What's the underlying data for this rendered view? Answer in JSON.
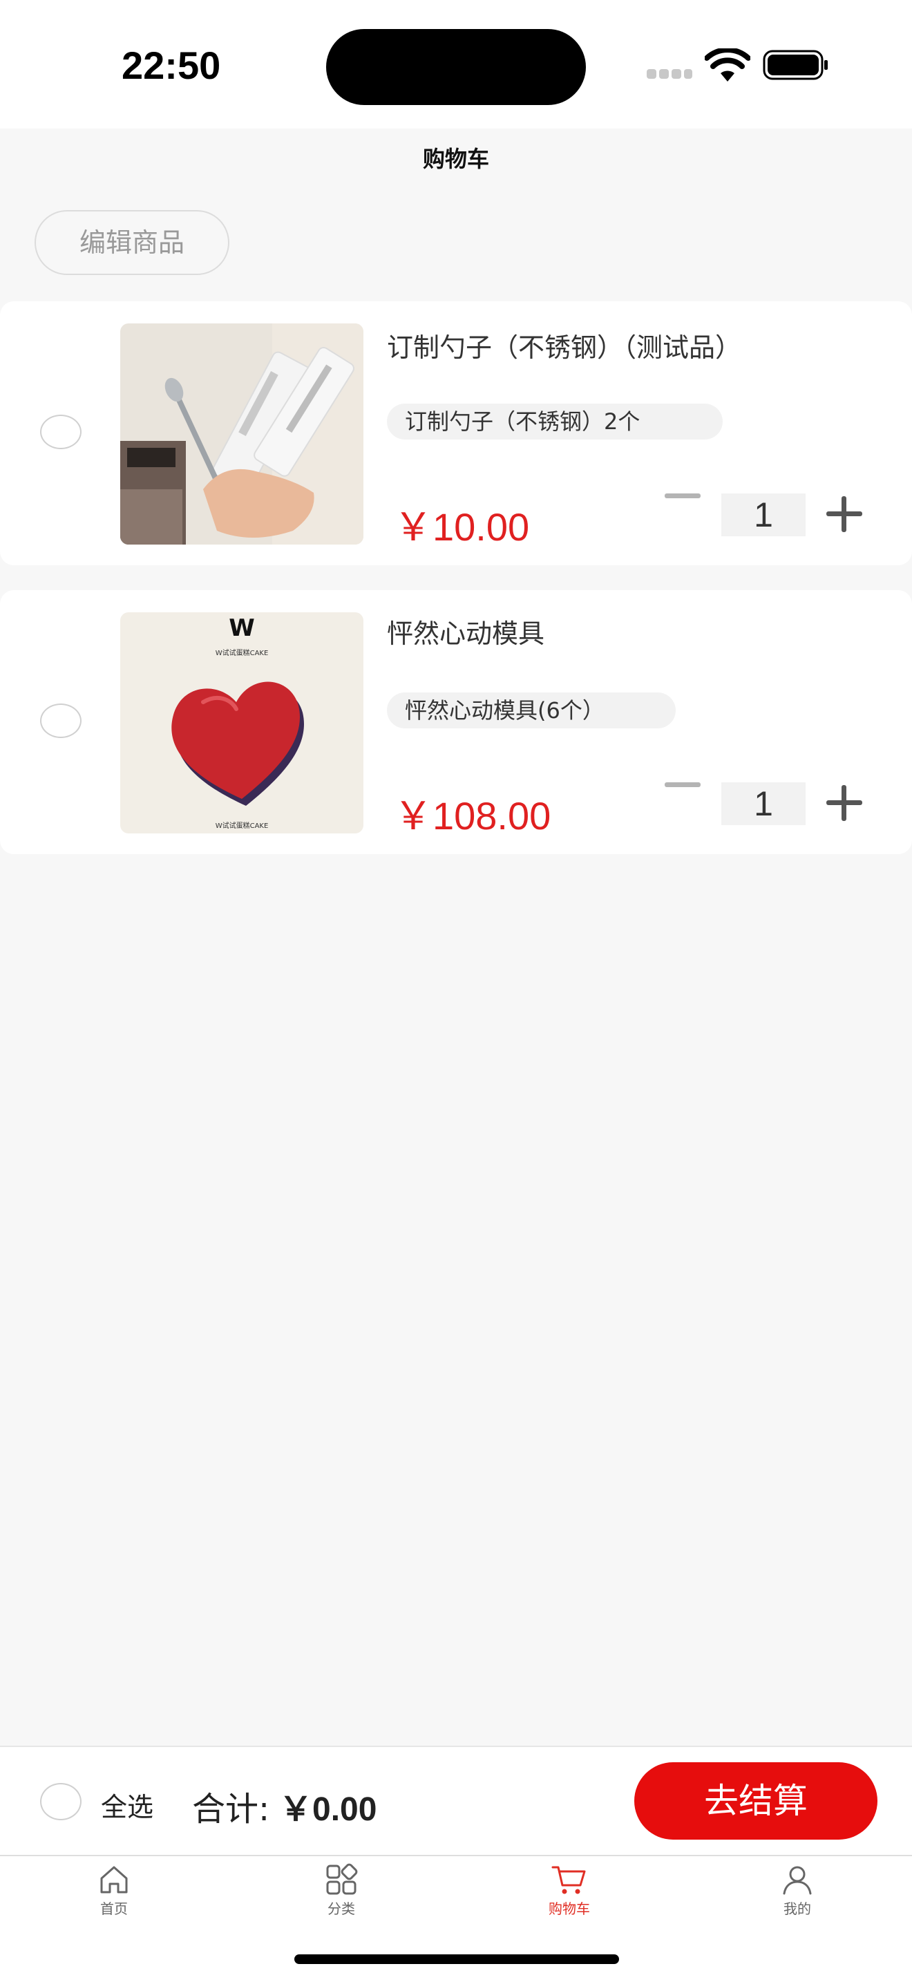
{
  "status_bar": {
    "time": "22:50"
  },
  "header": {
    "title": "购物车"
  },
  "edit_button_label": "编辑商品",
  "cart_items": [
    {
      "title": "订制勺子（不锈钢）（测试品）",
      "spec": "订制勺子（不锈钢）2个",
      "price": "￥10.00",
      "quantity": "1",
      "image_icon": "spoon-product-photo"
    },
    {
      "title": "怦然心动模具",
      "spec": "怦然心动模具(6个）",
      "price": "￥108.00",
      "quantity": "1",
      "image_icon": "heart-mold-product-photo",
      "brand_mark": "W",
      "brand_text": "W试试蛋糕CAKE"
    }
  ],
  "footer": {
    "select_all_label": "全选",
    "total_label": "合计:",
    "total_amount": "￥0.00",
    "checkout_label": "去结算"
  },
  "tabs": [
    {
      "label": "首页",
      "icon": "home-icon"
    },
    {
      "label": "分类",
      "icon": "category-icon"
    },
    {
      "label": "购物车",
      "icon": "cart-icon",
      "active": true
    },
    {
      "label": "我的",
      "icon": "user-icon"
    }
  ],
  "colors": {
    "accent": "#e60d0d",
    "price": "#e02020",
    "active_tab": "#e02e24",
    "background": "#f7f7f7"
  }
}
